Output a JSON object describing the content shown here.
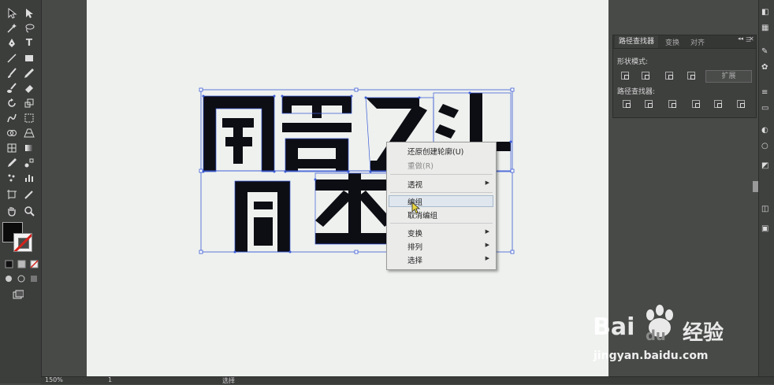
{
  "toolbar": {
    "tools": [
      "selection-tool",
      "direct-selection-tool",
      "magic-wand-tool",
      "lasso-tool",
      "pen-tool",
      "type-tool",
      "line-tool",
      "rectangle-tool",
      "paintbrush-tool",
      "pencil-tool",
      "blob-brush-tool",
      "eraser-tool",
      "rotate-tool",
      "scale-tool",
      "warp-tool",
      "free-transform-tool",
      "shape-builder-tool",
      "perspective-grid-tool",
      "mesh-tool",
      "gradient-tool",
      "eyedropper-tool",
      "blend-tool",
      "symbol-sprayer-tool",
      "column-graph-tool",
      "artboard-tool",
      "slice-tool",
      "hand-tool",
      "zoom-tool"
    ]
  },
  "panel": {
    "tabs": [
      "路径查找器",
      "变换",
      "对齐"
    ],
    "shape_modes_label": "形状模式:",
    "expand_label": "扩展",
    "pathfinders_label": "路径查找器:"
  },
  "context_menu": {
    "items": [
      {
        "label": "还原创建轮廓(U)",
        "enabled": true
      },
      {
        "label": "重做(R)",
        "enabled": false
      },
      {
        "label": "透视",
        "enabled": true,
        "submenu": true
      },
      {
        "label": "编组",
        "enabled": true,
        "highlighted": true
      },
      {
        "label": "取消编组",
        "enabled": true
      },
      {
        "label": "变换",
        "enabled": true,
        "submenu": true
      },
      {
        "label": "排列",
        "enabled": true,
        "submenu": true
      },
      {
        "label": "选择",
        "enabled": true,
        "submenu": true
      }
    ]
  },
  "status": {
    "zoom": "150%",
    "artboard": "1",
    "mode": "选择"
  },
  "watermark": {
    "brand": "Bai",
    "brand_suffix": "du",
    "product": "经验",
    "url": "jingyan.baidu.com"
  },
  "colors": {
    "fill": "#0b0b0b",
    "stroke_none": "#d3221b",
    "selection": "#3b5bd6"
  }
}
